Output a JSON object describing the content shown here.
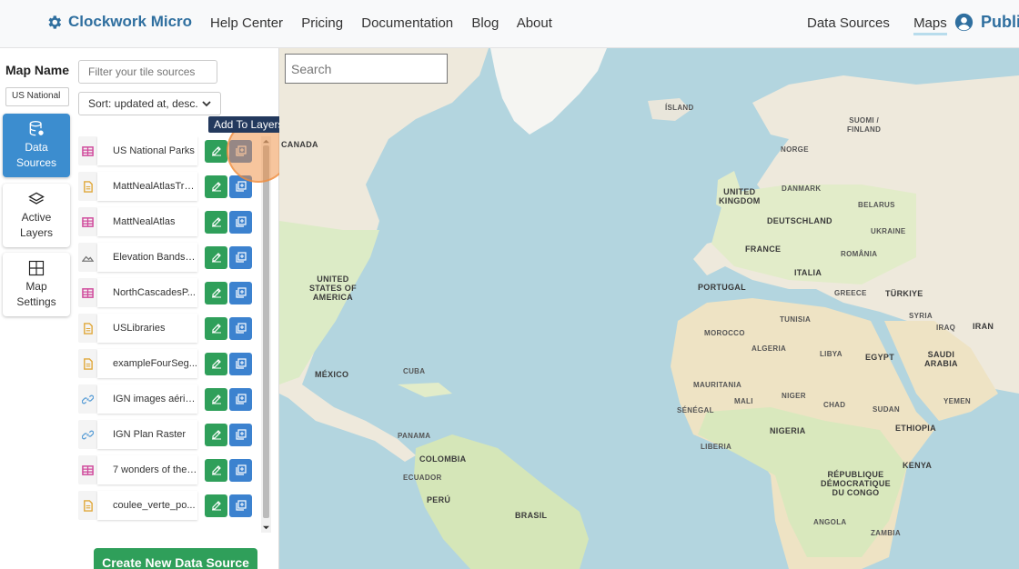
{
  "header": {
    "brand": "Clockwork Micro",
    "nav_left": [
      "Help Center",
      "Pricing",
      "Documentation",
      "Blog",
      "About"
    ],
    "nav_right": [
      "Data Sources",
      "Maps"
    ],
    "active_nav": "Maps",
    "user_label": "Public"
  },
  "sidebar": {
    "map_name_label": "Map Name",
    "map_name_value": "US National",
    "tabs": [
      {
        "label": "Data\nSources",
        "icon": "database-icon",
        "active": true
      },
      {
        "label": "Active\nLayers",
        "icon": "layers-icon",
        "active": false
      },
      {
        "label": "Map\nSettings",
        "icon": "grid-icon",
        "active": false
      }
    ]
  },
  "panel": {
    "filter_placeholder": "Filter your tile sources",
    "sort_label": "Sort: updated at, desc.",
    "tooltip": "Add To Layers",
    "create_button": "Create New Data Source",
    "sources": [
      {
        "name": "US National Parks",
        "type": "table"
      },
      {
        "name": "MattNealAtlasTra...",
        "type": "file"
      },
      {
        "name": "MattNealAtlas",
        "type": "table"
      },
      {
        "name": "Elevation Bands f...",
        "type": "terrain"
      },
      {
        "name": "NorthCascadesP...",
        "type": "table"
      },
      {
        "name": "USLibraries",
        "type": "file"
      },
      {
        "name": "exampleFourSeg...",
        "type": "file"
      },
      {
        "name": "IGN images aérie...",
        "type": "link"
      },
      {
        "name": "IGN Plan Raster",
        "type": "link"
      },
      {
        "name": "7 wonders of the ...",
        "type": "table"
      },
      {
        "name": "coulee_verte_po...",
        "type": "file"
      }
    ]
  },
  "map": {
    "search_placeholder": "Search",
    "labels": [
      {
        "text": "CANADA",
        "cls": ""
      },
      {
        "text": "ÍSLAND",
        "cls": "sm"
      },
      {
        "text": "NORGE",
        "cls": "sm"
      },
      {
        "text": "SUOMI /\nFINLAND",
        "cls": "sm"
      },
      {
        "text": "UNITED\nKINGDOM",
        "cls": ""
      },
      {
        "text": "DANMARK",
        "cls": "sm"
      },
      {
        "text": "BELARUS",
        "cls": "sm"
      },
      {
        "text": "DEUTSCHLAND",
        "cls": ""
      },
      {
        "text": "UKRAINE",
        "cls": "sm"
      },
      {
        "text": "FRANCE",
        "cls": ""
      },
      {
        "text": "ROMÂNIA",
        "cls": "sm"
      },
      {
        "text": "UNITED\nSTATES OF\nAMERICA",
        "cls": ""
      },
      {
        "text": "ITALIA",
        "cls": ""
      },
      {
        "text": "PORTUGAL",
        "cls": ""
      },
      {
        "text": "GREECE",
        "cls": "sm"
      },
      {
        "text": "TÜRKIYE",
        "cls": ""
      },
      {
        "text": "TUNISIA",
        "cls": "sm"
      },
      {
        "text": "SYRIA",
        "cls": "sm"
      },
      {
        "text": "IRAQ",
        "cls": "sm"
      },
      {
        "text": "IRAN",
        "cls": ""
      },
      {
        "text": "MOROCCO",
        "cls": "sm"
      },
      {
        "text": "ALGERIA",
        "cls": "sm"
      },
      {
        "text": "LIBYA",
        "cls": "sm"
      },
      {
        "text": "EGYPT",
        "cls": ""
      },
      {
        "text": "SAUDI\nARABIA",
        "cls": ""
      },
      {
        "text": "MÉXICO",
        "cls": ""
      },
      {
        "text": "CUBA",
        "cls": "sm"
      },
      {
        "text": "MAURITANIA",
        "cls": "sm"
      },
      {
        "text": "MALI",
        "cls": "sm"
      },
      {
        "text": "NIGER",
        "cls": "sm"
      },
      {
        "text": "CHAD",
        "cls": "sm"
      },
      {
        "text": "SUDAN",
        "cls": "sm"
      },
      {
        "text": "YEMEN",
        "cls": "sm"
      },
      {
        "text": "SÉNÉGAL",
        "cls": "sm"
      },
      {
        "text": "NIGERIA",
        "cls": ""
      },
      {
        "text": "ETHIOPIA",
        "cls": ""
      },
      {
        "text": "LIBERIA",
        "cls": "sm"
      },
      {
        "text": "PANAMA",
        "cls": "sm"
      },
      {
        "text": "COLOMBIA",
        "cls": ""
      },
      {
        "text": "ECUADOR",
        "cls": "sm"
      },
      {
        "text": "KENYA",
        "cls": ""
      },
      {
        "text": "RÉPUBLIQUE\nDÉMOCRATIQUE\nDU CONGO",
        "cls": ""
      },
      {
        "text": "PERÚ",
        "cls": ""
      },
      {
        "text": "BRASIL",
        "cls": ""
      },
      {
        "text": "ANGOLA",
        "cls": "sm"
      },
      {
        "text": "ZAMBIA",
        "cls": "sm"
      }
    ]
  }
}
